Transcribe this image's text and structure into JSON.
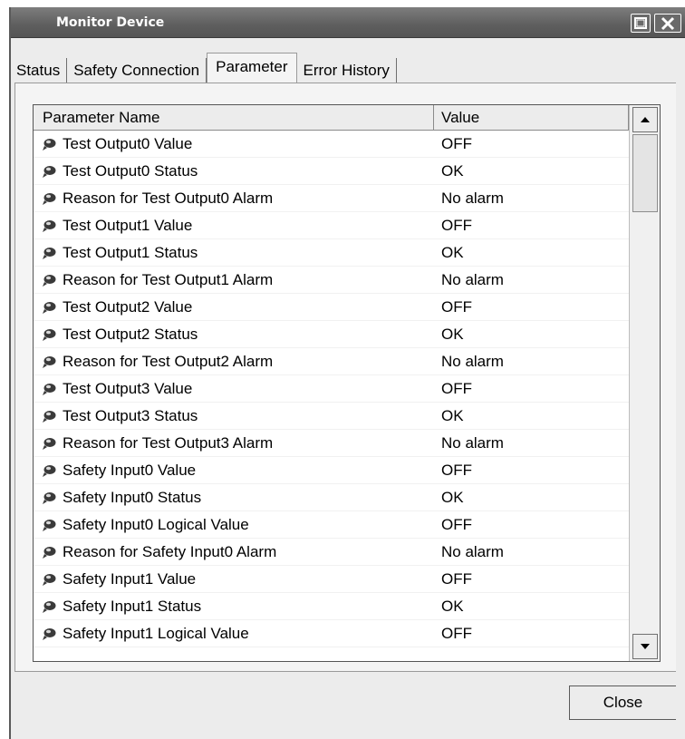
{
  "window": {
    "title": "Monitor Device",
    "maximize_icon": "maximize-icon",
    "close_icon": "close-icon"
  },
  "tabs": [
    {
      "label": "Status",
      "active": false
    },
    {
      "label": "Safety Connection",
      "active": false
    },
    {
      "label": "Parameter",
      "active": true
    },
    {
      "label": "Error History",
      "active": false
    }
  ],
  "grid": {
    "columns": [
      "Parameter Name",
      "Value"
    ],
    "row_icon": "parameter-icon",
    "rows": [
      {
        "name": "Test Output0 Value",
        "value": "OFF"
      },
      {
        "name": "Test Output0 Status",
        "value": "OK"
      },
      {
        "name": "Reason for Test Output0 Alarm",
        "value": "No alarm"
      },
      {
        "name": "Test Output1 Value",
        "value": "OFF"
      },
      {
        "name": "Test Output1 Status",
        "value": "OK"
      },
      {
        "name": "Reason for Test Output1 Alarm",
        "value": "No alarm"
      },
      {
        "name": "Test Output2 Value",
        "value": "OFF"
      },
      {
        "name": "Test Output2 Status",
        "value": "OK"
      },
      {
        "name": "Reason for Test Output2 Alarm",
        "value": "No alarm"
      },
      {
        "name": "Test Output3 Value",
        "value": "OFF"
      },
      {
        "name": "Test Output3 Status",
        "value": "OK"
      },
      {
        "name": "Reason for Test Output3 Alarm",
        "value": "No alarm"
      },
      {
        "name": "Safety Input0 Value",
        "value": "OFF"
      },
      {
        "name": "Safety Input0 Status",
        "value": "OK"
      },
      {
        "name": "Safety Input0 Logical Value",
        "value": "OFF"
      },
      {
        "name": "Reason for Safety Input0 Alarm",
        "value": "No alarm"
      },
      {
        "name": "Safety Input1 Value",
        "value": "OFF"
      },
      {
        "name": "Safety Input1 Status",
        "value": "OK"
      },
      {
        "name": "Safety Input1 Logical Value",
        "value": "OFF"
      }
    ]
  },
  "scrollbar": {
    "up_icon": "scroll-up-arrow-icon",
    "down_icon": "scroll-down-arrow-icon"
  },
  "footer": {
    "close_label": "Close"
  }
}
